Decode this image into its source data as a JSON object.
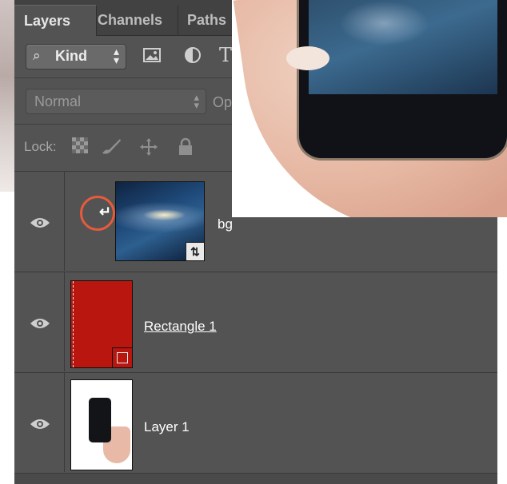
{
  "tabs": [
    {
      "label": "Layers",
      "active": true
    },
    {
      "label": "Channels",
      "active": false
    },
    {
      "label": "Paths",
      "active": false
    }
  ],
  "filter": {
    "kind_label": "Kind",
    "icons": [
      "search-icon",
      "image-filter-icon",
      "adjustment-filter-icon",
      "type-filter-icon"
    ]
  },
  "blend": {
    "mode": "Normal",
    "opacity_label_partial": "Op"
  },
  "lock": {
    "label": "Lock:",
    "icons": [
      "lock-transparent-icon",
      "lock-image-icon",
      "lock-position-icon",
      "lock-all-icon"
    ]
  },
  "layers": [
    {
      "name": "bg",
      "thumbnail": "galaxy-wallpaper",
      "smart_object": true,
      "clipping_mask": true,
      "visible": true
    },
    {
      "name": "Rectangle 1",
      "thumbnail": "red-rectangle",
      "shape_layer": true,
      "visible": true
    },
    {
      "name": "Layer 1",
      "thumbnail": "hand-holding-phone",
      "visible": true
    }
  ],
  "colors": {
    "panel_bg": "#535353",
    "tab_bar_bg": "#424242",
    "highlight_ring": "#e85a3c",
    "rectangle_fill": "#b8160f"
  }
}
